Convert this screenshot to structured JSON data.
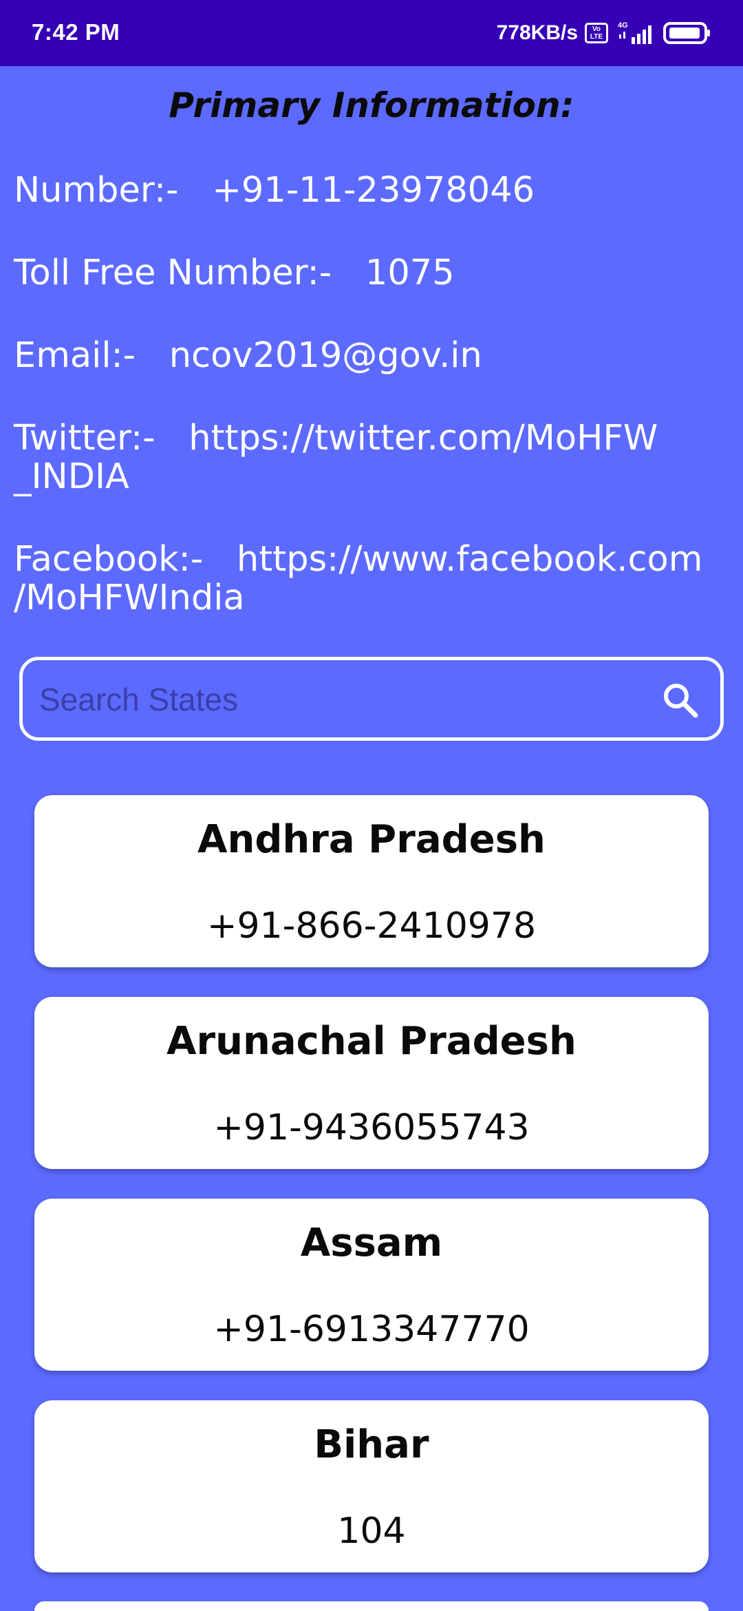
{
  "status_bar": {
    "time": "7:42 PM",
    "net_speed": "778KB/s",
    "volte_label_top": "Vo",
    "volte_label_bottom": "LTE",
    "network_label": "4G",
    "icons": [
      "volte-icon",
      "signal-icon",
      "battery-icon"
    ]
  },
  "primary": {
    "title": "Primary Information:",
    "number_label": "Number:-",
    "number_value": "+91-11-23978046",
    "tollfree_label": "Toll Free Number:-",
    "tollfree_value": "1075",
    "email_label": "Email:-",
    "email_value": "ncov2019@gov.in",
    "twitter_label": "Twitter:-",
    "twitter_value_line1": "https://twitter.com/MoHFW",
    "twitter_value_line2": "_INDIA",
    "facebook_label": "Facebook:-",
    "facebook_value_line1": "https://www.facebook.com",
    "facebook_value_line2": "/MoHFWIndia"
  },
  "search": {
    "placeholder": "Search States",
    "value": "",
    "icon": "search-icon"
  },
  "states": [
    {
      "name": "Andhra Pradesh",
      "number": "+91-866-2410978"
    },
    {
      "name": "Arunachal Pradesh",
      "number": "+91-9436055743"
    },
    {
      "name": "Assam",
      "number": "+91-6913347770"
    },
    {
      "name": "Bihar",
      "number": "104"
    }
  ],
  "colors": {
    "background": "#5c6aff",
    "status_bar": "#3600b4",
    "card": "#ffffff",
    "text_light": "#ffffff",
    "text_dark": "#0a0a0a"
  }
}
